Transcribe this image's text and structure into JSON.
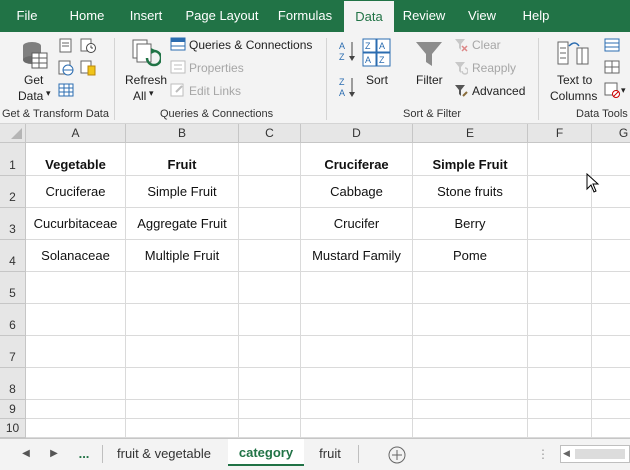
{
  "ribbon_tabs": [
    "File",
    "Home",
    "Insert",
    "Page Layout",
    "Formulas",
    "Data",
    "Review",
    "View",
    "Help"
  ],
  "active_tab": "Data",
  "ribbon": {
    "get_data": {
      "line1": "Get",
      "line2": "Data"
    },
    "refresh_all": {
      "line1": "Refresh",
      "line2": "All"
    },
    "queries_connections": "Queries & Connections",
    "properties": "Properties",
    "edit_links": "Edit Links",
    "sort": "Sort",
    "filter": "Filter",
    "clear": "Clear",
    "reapply": "Reapply",
    "advanced": "Advanced",
    "text_to_columns": {
      "line1": "Text to",
      "line2": "Columns"
    },
    "groups": {
      "get_transform": "Get & Transform Data",
      "queries": "Queries & Connections",
      "sort_filter": "Sort & Filter",
      "data_tools": "Data Tools"
    }
  },
  "columns": [
    "A",
    "B",
    "C",
    "D",
    "E",
    "F",
    "G"
  ],
  "rows": [
    "1",
    "2",
    "3",
    "4",
    "5",
    "6",
    "7",
    "8",
    "9",
    "10"
  ],
  "cells": {
    "A1": "Vegetable",
    "B1": "Fruit",
    "D1": "Cruciferae",
    "E1": "Simple Fruit",
    "A2": "Cruciferae",
    "B2": "Simple Fruit",
    "D2": "Cabbage",
    "E2": "Stone fruits",
    "A3": "Cucurbitaceae",
    "B3": "Aggregate Fruit",
    "D3": "Crucifer",
    "E3": "Berry",
    "A4": "Solanaceae",
    "B4": "Multiple Fruit",
    "D4": "Mustard Family",
    "E4": "Pome"
  },
  "sheets": {
    "more": "...",
    "tabs": [
      "fruit & vegetable",
      "category",
      "fruit"
    ],
    "active": "category"
  },
  "colors": {
    "accent": "#217346"
  }
}
